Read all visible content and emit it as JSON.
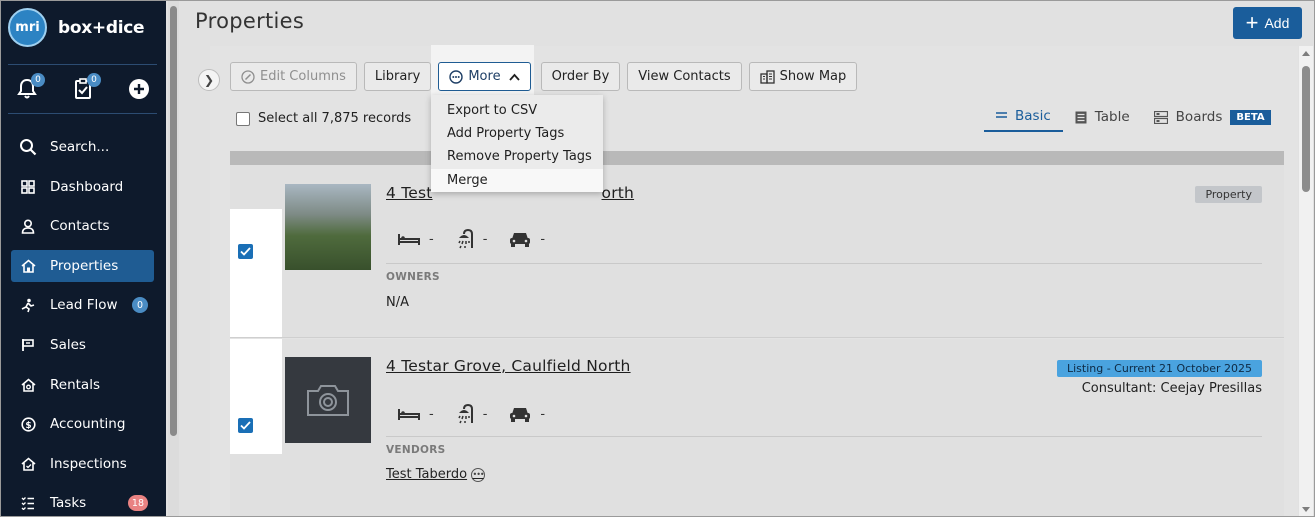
{
  "brand": {
    "logo_text": "mri",
    "name": "box+dice"
  },
  "topbar": {
    "notifications_count": "0",
    "tasks_count": "0"
  },
  "sidebar": {
    "items": [
      {
        "label": "Search...",
        "icon": "search-icon"
      },
      {
        "label": "Dashboard",
        "icon": "dashboard-icon"
      },
      {
        "label": "Contacts",
        "icon": "contacts-icon"
      },
      {
        "label": "Properties",
        "icon": "home-icon"
      },
      {
        "label": "Lead Flow",
        "icon": "lead-flow-icon",
        "badge": "0"
      },
      {
        "label": "Sales",
        "icon": "sales-icon"
      },
      {
        "label": "Rentals",
        "icon": "rentals-icon"
      },
      {
        "label": "Accounting",
        "icon": "accounting-icon"
      },
      {
        "label": "Inspections",
        "icon": "inspections-icon"
      },
      {
        "label": "Tasks",
        "icon": "tasks-icon",
        "badge": "18"
      }
    ],
    "active": "Properties"
  },
  "header": {
    "title": "Properties",
    "add_label": "Add"
  },
  "toolbar": {
    "edit_columns": "Edit Columns",
    "library": "Library",
    "more": "More",
    "order_by": "Order By",
    "view_contacts": "View Contacts",
    "show_map": "Show Map"
  },
  "more_menu": [
    "Export to CSV",
    "Add Property Tags",
    "Remove Property Tags",
    "Merge"
  ],
  "select_all_label": "Select all 7,875 records",
  "views": {
    "basic": "Basic",
    "table": "Table",
    "boards": "Boards",
    "beta": "BETA",
    "active": "Basic"
  },
  "records": [
    {
      "title_left": "4 Test",
      "title_right": "orth",
      "checked": true,
      "tag": "Property",
      "beds": "-",
      "baths": "-",
      "cars": "-",
      "section_label": "OWNERS",
      "section_value": "N/A"
    },
    {
      "title": "4 Testar Grove, Caulfield North",
      "checked": true,
      "tag": "Listing - Current 21 October 2025",
      "consultant": "Consultant: Ceejay Presillas",
      "beds": "-",
      "baths": "-",
      "cars": "-",
      "section_label": "VENDORS",
      "section_value": "Test Taberdo"
    }
  ],
  "colors": {
    "sidebar_bg": "#0e1a2c",
    "accent": "#1a5d9b",
    "active_nav": "#1f5c93",
    "listing_tag": "#4aa3df"
  }
}
